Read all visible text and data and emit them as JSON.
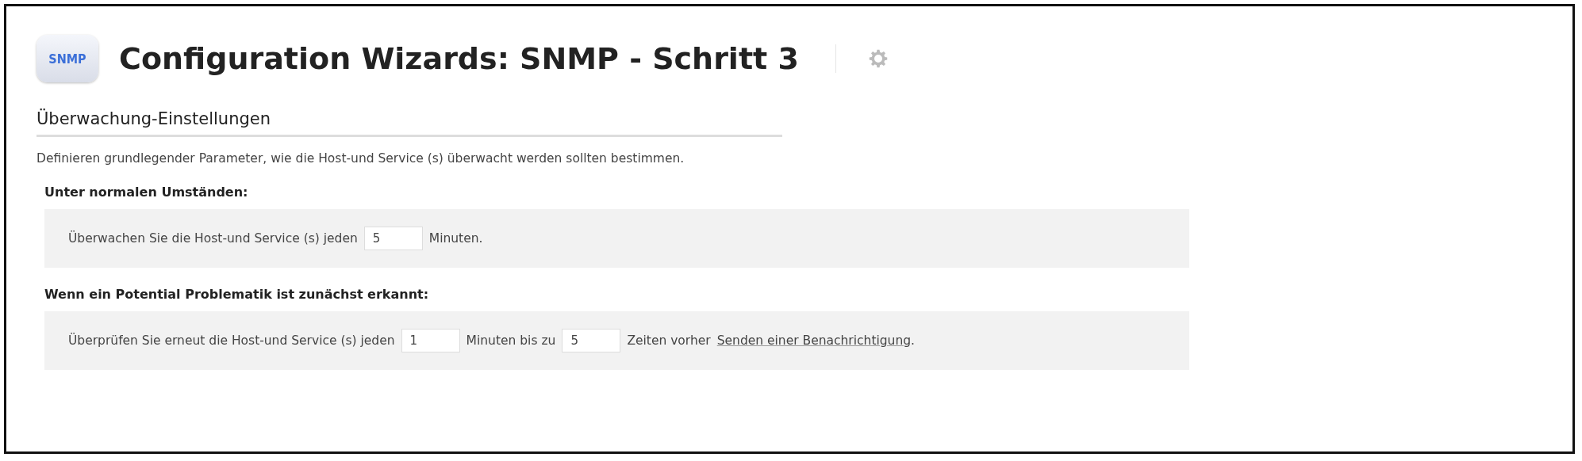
{
  "header": {
    "title": "Configuration Wizards: SNMP - Schritt 3",
    "logo_text": "SNMP"
  },
  "section": {
    "title": "Überwachung-Einstellungen",
    "description": "Definieren grundlegender Parameter, wie die Host-und Service (s) überwacht werden sollten bestimmen."
  },
  "groups": [
    {
      "label": "Unter normalen Umständen:",
      "parts": [
        {
          "kind": "text",
          "text": "Überwachen Sie die Host-und Service (s) jeden"
        },
        {
          "kind": "input",
          "value": "5"
        },
        {
          "kind": "text",
          "text": "Minuten."
        }
      ]
    },
    {
      "label": "Wenn ein Potential Problematik ist zunächst erkannt:",
      "parts": [
        {
          "kind": "text",
          "text": "Überprüfen Sie erneut die Host-und Service (s) jeden"
        },
        {
          "kind": "input",
          "value": "1"
        },
        {
          "kind": "text",
          "text": "Minuten bis zu"
        },
        {
          "kind": "input",
          "value": "5"
        },
        {
          "kind": "text",
          "text": "Zeiten vorher"
        },
        {
          "kind": "link",
          "text": "Senden einer Benachrichtigung"
        },
        {
          "kind": "tail",
          "text": "."
        }
      ]
    }
  ]
}
